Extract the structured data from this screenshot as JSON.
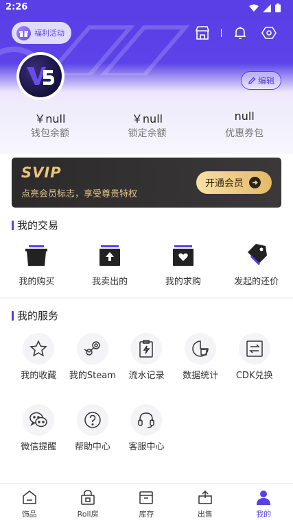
{
  "status_bar": {
    "time": "2:26"
  },
  "header": {
    "promo_label": "福利活动",
    "edit_label": "编辑"
  },
  "balances": [
    {
      "value": "￥null",
      "label": "钱包余额"
    },
    {
      "value": "￥null",
      "label": "锁定余额"
    },
    {
      "value": "null",
      "label": "优惠券包"
    }
  ],
  "svip": {
    "logo": "SVIP",
    "subtitle": "点亮会员标志，享受尊贵特权",
    "button": "开通会员",
    "colors": {
      "gold": "#e9c57a",
      "bg": "#2c2a2a"
    }
  },
  "trade": {
    "title": "我的交易",
    "items": [
      {
        "label": "我的购买",
        "icon": "basket-icon"
      },
      {
        "label": "我卖出的",
        "icon": "upload-box-icon"
      },
      {
        "label": "我的求购",
        "icon": "heart-box-icon"
      },
      {
        "label": "发起的还价",
        "icon": "price-tag-icon"
      }
    ]
  },
  "services": {
    "title": "我的服务",
    "items": [
      {
        "label": "我的收藏",
        "icon": "star-icon"
      },
      {
        "label": "我的Steam",
        "icon": "steam-icon"
      },
      {
        "label": "流水记录",
        "icon": "clipboard-bolt-icon"
      },
      {
        "label": "数据统计",
        "icon": "pie-chart-icon"
      },
      {
        "label": "CDK兑换",
        "icon": "exchange-icon"
      },
      {
        "label": "微信提醒",
        "icon": "wechat-icon"
      },
      {
        "label": "帮助中心",
        "icon": "help-icon"
      },
      {
        "label": "客服中心",
        "icon": "headset-icon"
      }
    ]
  },
  "bottom_nav": [
    {
      "label": "饰品",
      "icon": "home-icon"
    },
    {
      "label": "Roll房",
      "icon": "lock-bag-icon"
    },
    {
      "label": "库存",
      "icon": "inventory-icon"
    },
    {
      "label": "出售",
      "icon": "sell-box-icon"
    },
    {
      "label": "我的",
      "icon": "user-icon",
      "active": true
    }
  ],
  "colors": {
    "accent": "#5a3ee6"
  }
}
